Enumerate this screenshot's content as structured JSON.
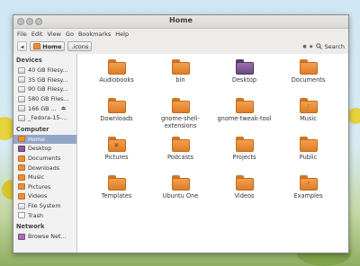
{
  "window": {
    "title": "Home"
  },
  "menubar": [
    "File",
    "Edit",
    "View",
    "Go",
    "Bookmarks",
    "Help"
  ],
  "toolbar": {
    "back_glyph": "◂",
    "path": [
      {
        "label": "Home",
        "active": true
      },
      {
        "label": ".icons",
        "active": false
      }
    ],
    "view_glyph1": "●",
    "view_glyph2": "◆",
    "search_label": "Search"
  },
  "sidebar": {
    "devices_heading": "Devices",
    "devices": [
      {
        "label": "40 GB Filesy...",
        "eject": ""
      },
      {
        "label": "35 GB Filesy...",
        "eject": ""
      },
      {
        "label": "90 GB Filesy...",
        "eject": ""
      },
      {
        "label": "580 GB Files...",
        "eject": ""
      },
      {
        "label": "166 GB ...",
        "eject": "⏏"
      },
      {
        "label": "_Fedora-15-...",
        "eject": ""
      }
    ],
    "computer_heading": "Computer",
    "computer": [
      {
        "label": "Home",
        "icon": "home",
        "selected": true
      },
      {
        "label": "Desktop",
        "icon": "desk",
        "selected": false
      },
      {
        "label": "Documents",
        "icon": "folder",
        "selected": false
      },
      {
        "label": "Downloads",
        "icon": "folder",
        "selected": false
      },
      {
        "label": "Music",
        "icon": "folder",
        "selected": false
      },
      {
        "label": "Pictures",
        "icon": "folder",
        "selected": false
      },
      {
        "label": "Videos",
        "icon": "folder",
        "selected": false
      },
      {
        "label": "File System",
        "icon": "drive",
        "selected": false
      },
      {
        "label": "Trash",
        "icon": "trash",
        "selected": false
      }
    ],
    "network_heading": "Network",
    "network": [
      {
        "label": "Browse Net...",
        "icon": "net"
      }
    ]
  },
  "files": [
    {
      "name": "Audiobooks",
      "icon": "folder",
      "emblem": ""
    },
    {
      "name": "bin",
      "icon": "folder",
      "emblem": ""
    },
    {
      "name": "Desktop",
      "icon": "desktop",
      "emblem": ""
    },
    {
      "name": "Documents",
      "icon": "folder",
      "emblem": ""
    },
    {
      "name": "Downloads",
      "icon": "folder",
      "emblem": ""
    },
    {
      "name": "gnome-shell-extensions",
      "icon": "folder",
      "emblem": ""
    },
    {
      "name": "gnome-tweak-tool",
      "icon": "folder",
      "emblem": ""
    },
    {
      "name": "Music",
      "icon": "folder",
      "emblem": "♪"
    },
    {
      "name": "Pictures",
      "icon": "folder",
      "emblem": "▣"
    },
    {
      "name": "Podcasts",
      "icon": "folder",
      "emblem": ""
    },
    {
      "name": "Projects",
      "icon": "folder",
      "emblem": ""
    },
    {
      "name": "Public",
      "icon": "folder",
      "emblem": ""
    },
    {
      "name": "Templates",
      "icon": "folder",
      "emblem": ""
    },
    {
      "name": "Ubuntu One",
      "icon": "folder",
      "emblem": ""
    },
    {
      "name": "Videos",
      "icon": "folder",
      "emblem": ""
    },
    {
      "name": "Examples",
      "icon": "folder",
      "emblem": "↗"
    }
  ],
  "colors": {
    "folder": "#e98f3c",
    "selection": "#93a6c6"
  }
}
